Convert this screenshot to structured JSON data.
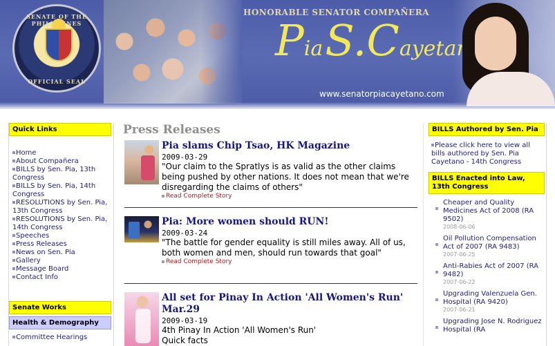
{
  "banner": {
    "seal_top_text": "SENATE OF THE PHILIPPINES",
    "seal_bottom_text": "OFFICIAL SEAL",
    "honorable": "HONORABLE SENATOR COMPAÑERA",
    "name_p": "P",
    "name_ia": "ia",
    "name_s": "S.",
    "name_c": "C",
    "name_ayetano": "ayetano",
    "url": "www.senatorpiacayetano.com"
  },
  "left": {
    "quick_links_title": "Quick Links",
    "quick_links": [
      "Home",
      "About Compañera",
      "BILLS by Sen. Pia, 13th Congress",
      "BILLS by Sen. Pia, 14th Congress",
      "RESOLUTIONS by Sen. Pia, 13th Congress",
      "RESOLUTIONS by Sen. Pia, 14th Congress",
      "Speeches",
      "Press Releases",
      "News on Sen. Pia",
      "Gallery",
      "Message Board",
      "Contact Info"
    ],
    "senate_works_title": "Senate Works",
    "health_title": "Health & Demography",
    "committee": "Committee Hearings"
  },
  "center": {
    "title": "Press Releases",
    "stories": [
      {
        "headline": "Pia slams Chip Tsao, HK Magazine",
        "date": "2009-03-29",
        "quote": "\"Our claim to the Spratlys is as valid as the other claims being pushed by other nations. It does not mean that we're disregarding the claims of others\"",
        "more": "Read Complete Story"
      },
      {
        "headline": "Pia: More women should RUN!",
        "date": "2009-03-24",
        "quote": "\"The battle for gender equality is still miles away. All of us, both women and men, should run towards that goal\"",
        "more": "Read Complete Story"
      },
      {
        "headline": "All set for Pinay In Action 'All Women's Run' Mar.29",
        "date": "2009-03-19",
        "quote": "4th Pinay In Action 'All Women's Run'",
        "sub": "Quick facts"
      }
    ]
  },
  "right": {
    "bills_title": "BILLS Authored by Sen. Pia",
    "bills_link": "Please click here to view all bills authored by Sen. Pia Cayetano - 14th Congress",
    "enacted_title": "BILLS Enacted into Law, 13th Congress",
    "laws": [
      {
        "title": "Cheaper and Quality Medicines Act of 2008 (RA 9502)",
        "date": "2008-06-06"
      },
      {
        "title": "Oil Pollution Compensation Act of 2007 (RA 9483)",
        "date": "2007-06-25"
      },
      {
        "title": "Anti-Rabies Act of 2007 (RA 9482)",
        "date": "2007-06-22"
      },
      {
        "title": "Upgrading Valenzuela Gen. Hospital (RA 9420)",
        "date": "2007-06-21"
      },
      {
        "title": "Upgrading Jose N. Rodriguez Hospital (RA",
        "date": ""
      }
    ]
  }
}
